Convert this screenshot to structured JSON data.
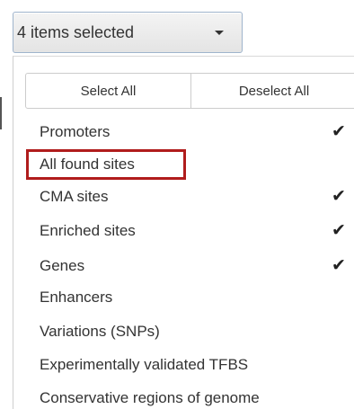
{
  "dropdown": {
    "button_label": "4 items selected",
    "caret_icon": "caret-down-icon"
  },
  "actions": {
    "select_all": "Select All",
    "deselect_all": "Deselect All"
  },
  "items": [
    {
      "label": "Promoters",
      "checked": true
    },
    {
      "label": "All found sites",
      "checked": false,
      "highlighted": true
    },
    {
      "label": "CMA sites",
      "checked": true
    },
    {
      "label": "Enriched sites",
      "checked": true
    },
    {
      "label": "Genes",
      "checked": true
    },
    {
      "label": "Enhancers",
      "checked": false
    },
    {
      "label": "Variations (SNPs)",
      "checked": false
    },
    {
      "label": "Experimentally validated TFBS",
      "checked": false
    },
    {
      "label": "Conservative regions of genome",
      "checked": false
    }
  ],
  "check_glyph": "✔",
  "highlight_color": "#b01c1c"
}
